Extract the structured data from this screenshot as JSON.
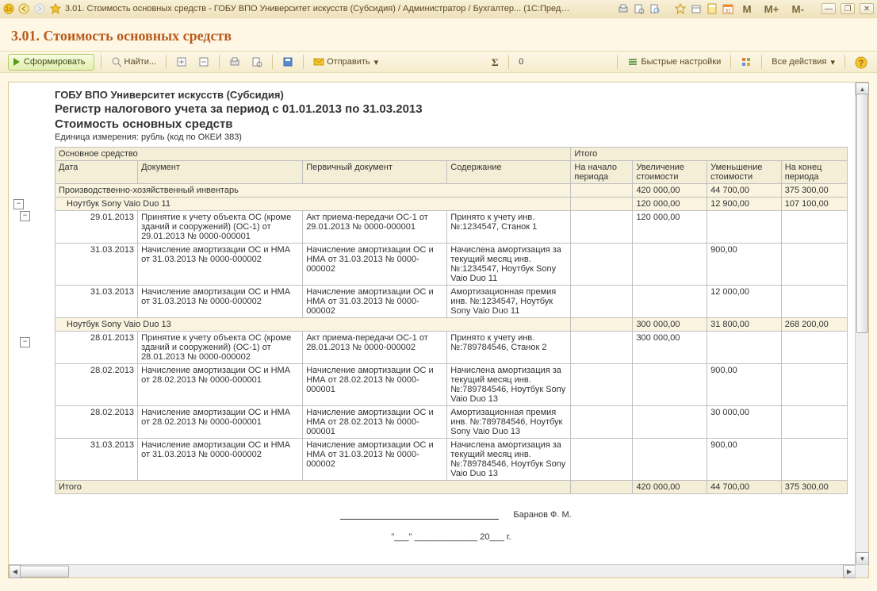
{
  "window": {
    "title": "3.01. Стоимость основных средств - ГОБУ ВПО Университет искусств (Субсидия) / Администратор / Бухгалтер...   (1С:Предприятие)",
    "m_labels": [
      "M",
      "M+",
      "M-"
    ]
  },
  "report_title": "3.01. Стоимость основных средств",
  "toolbar": {
    "generate": "Сформировать",
    "find": "Найти...",
    "send": "Отправить",
    "sum_value": "0",
    "quick_settings": "Быстрые настройки",
    "all_actions": "Все действия"
  },
  "header": {
    "org": "ГОБУ ВПО Университет искусств (Субсидия)",
    "reg": "Регистр налогового учета за период с 01.01.2013 по 31.03.2013",
    "sub": "Стоимость основных средств",
    "unit": "Единица измерения: рубль (код по ОКЕИ 383)"
  },
  "colhead": {
    "main_asset": "Основное средство",
    "total": "Итого",
    "date": "Дата",
    "doc": "Документ",
    "prim": "Первичный документ",
    "content": "Содержание",
    "begin": "На начало периода",
    "inc": "Увеличение стоимости",
    "dec": "Уменьшение стоимости",
    "end": "На конец периода"
  },
  "groups": [
    {
      "name": "Производственно-хозяйственный инвентарь",
      "begin": "",
      "inc": "420 000,00",
      "dec": "44 700,00",
      "end": "375 300,00",
      "items": [
        {
          "name": "Ноутбук Sony Vaio Duo 11",
          "begin": "",
          "inc": "120 000,00",
          "dec": "12 900,00",
          "end": "107 100,00",
          "rows": [
            {
              "date": "29.01.2013",
              "doc": "Принятие к учету объекта ОС (кроме зданий и сооружений) (ОС-1) от 29.01.2013 № 0000-000001",
              "prim": "Акт приема-передачи ОС-1 от 29.01.2013 № 0000-000001",
              "content": "Принято к учету инв. №:1234547, Станок 1",
              "begin": "",
              "inc": "120 000,00",
              "dec": "",
              "end": ""
            },
            {
              "date": "31.03.2013",
              "doc": "Начисление амортизации ОС и НМА от 31.03.2013 № 0000-000002",
              "prim": "Начисление амортизации ОС и НМА от 31.03.2013 № 0000-000002",
              "content": "Начислена амортизация за текущий месяц инв. №:1234547, Ноутбук Sony Vaio Duo 11",
              "begin": "",
              "inc": "",
              "dec": "900,00",
              "end": ""
            },
            {
              "date": "31.03.2013",
              "doc": "Начисление амортизации ОС и НМА от 31.03.2013 № 0000-000002",
              "prim": "Начисление амортизации ОС и НМА от 31.03.2013 № 0000-000002",
              "content": "Амортизационная премия инв. №:1234547, Ноутбук Sony Vaio Duo 11",
              "begin": "",
              "inc": "",
              "dec": "12 000,00",
              "end": ""
            }
          ]
        },
        {
          "name": "Ноутбук Sony Vaio Duo 13",
          "begin": "",
          "inc": "300 000,00",
          "dec": "31 800,00",
          "end": "268 200,00",
          "rows": [
            {
              "date": "28.01.2013",
              "doc": "Принятие к учету объекта ОС (кроме зданий и сооружений) (ОС-1) от 28.01.2013 № 0000-000002",
              "prim": "Акт приема-передачи ОС-1 от 28.01.2013 № 0000-000002",
              "content": "Принято к учету инв. №:789784546, Станок 2",
              "begin": "",
              "inc": "300 000,00",
              "dec": "",
              "end": ""
            },
            {
              "date": "28.02.2013",
              "doc": "Начисление амортизации ОС и НМА от 28.02.2013 № 0000-000001",
              "prim": "Начисление амортизации ОС и НМА от 28.02.2013 № 0000-000001",
              "content": "Начислена амортизация за текущий месяц инв. №:789784546, Ноутбук Sony Vaio Duo 13",
              "begin": "",
              "inc": "",
              "dec": "900,00",
              "end": ""
            },
            {
              "date": "28.02.2013",
              "doc": "Начисление амортизации ОС и НМА от 28.02.2013 № 0000-000001",
              "prim": "Начисление амортизации ОС и НМА от 28.02.2013 № 0000-000001",
              "content": "Амортизационная премия инв. №:789784546, Ноутбук Sony Vaio Duo 13",
              "begin": "",
              "inc": "",
              "dec": "30 000,00",
              "end": ""
            },
            {
              "date": "31.03.2013",
              "doc": "Начисление амортизации ОС и НМА от 31.03.2013 № 0000-000002",
              "prim": "Начисление амортизации ОС и НМА от 31.03.2013 № 0000-000002",
              "content": "Начислена амортизация за текущий месяц инв. №:789784546, Ноутбук Sony Vaio Duo 13",
              "begin": "",
              "inc": "",
              "dec": "900,00",
              "end": ""
            }
          ]
        }
      ]
    }
  ],
  "totals": {
    "label": "Итого",
    "begin": "",
    "inc": "420 000,00",
    "dec": "44 700,00",
    "end": "375 300,00"
  },
  "signature": {
    "name": "Баранов Ф. М.",
    "date_tpl": "\"___\" _____________ 20___ г."
  }
}
